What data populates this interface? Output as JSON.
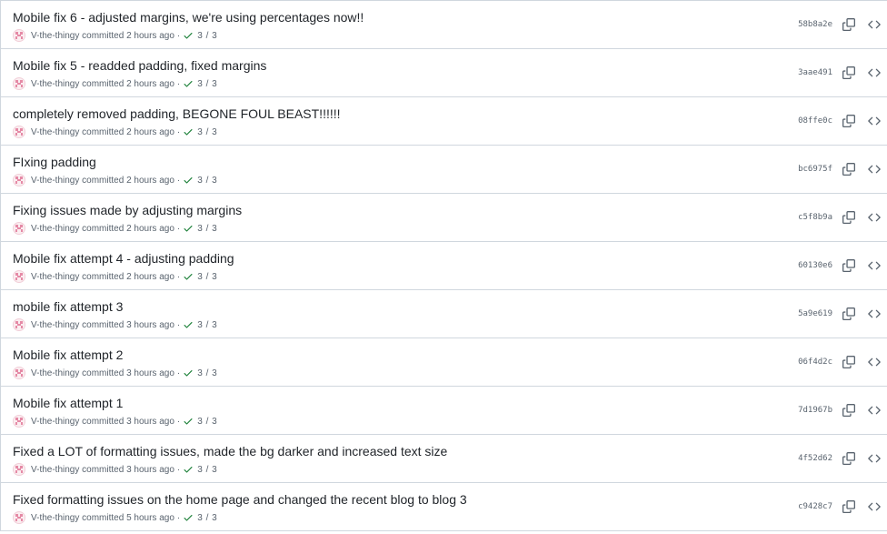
{
  "colors": {
    "border": "#d0d7de",
    "text": "#1f2328",
    "muted": "#59636e",
    "success": "#1a7f37"
  },
  "icons": {
    "avatar": "identicon-avatar-icon",
    "check": "check-icon",
    "copy": "copy-icon",
    "browse": "code-brackets-icon"
  },
  "commits": [
    {
      "message": "Mobile fix 6 - adjusted margins, we're using percentages now!!",
      "author": "V-the-thingy",
      "verb": "committed",
      "time": "2 hours ago",
      "dot": "·",
      "checks": "3 / 3",
      "sha": "58b8a2e"
    },
    {
      "message": "Mobile fix 5 - readded padding, fixed margins",
      "author": "V-the-thingy",
      "verb": "committed",
      "time": "2 hours ago",
      "dot": "·",
      "checks": "3 / 3",
      "sha": "3aae491"
    },
    {
      "message": "completely removed padding, BEGONE FOUL BEAST!!!!!!",
      "author": "V-the-thingy",
      "verb": "committed",
      "time": "2 hours ago",
      "dot": "·",
      "checks": "3 / 3",
      "sha": "08ffe0c"
    },
    {
      "message": "FIxing padding",
      "author": "V-the-thingy",
      "verb": "committed",
      "time": "2 hours ago",
      "dot": "·",
      "checks": "3 / 3",
      "sha": "bc6975f"
    },
    {
      "message": "Fixing issues made by adjusting margins",
      "author": "V-the-thingy",
      "verb": "committed",
      "time": "2 hours ago",
      "dot": "·",
      "checks": "3 / 3",
      "sha": "c5f8b9a"
    },
    {
      "message": "Mobile fix attempt 4 - adjusting padding",
      "author": "V-the-thingy",
      "verb": "committed",
      "time": "2 hours ago",
      "dot": "·",
      "checks": "3 / 3",
      "sha": "60130e6"
    },
    {
      "message": "mobile fix attempt 3",
      "author": "V-the-thingy",
      "verb": "committed",
      "time": "3 hours ago",
      "dot": "·",
      "checks": "3 / 3",
      "sha": "5a9e619"
    },
    {
      "message": "Mobile fix attempt 2",
      "author": "V-the-thingy",
      "verb": "committed",
      "time": "3 hours ago",
      "dot": "·",
      "checks": "3 / 3",
      "sha": "06f4d2c"
    },
    {
      "message": "Mobile fix attempt 1",
      "author": "V-the-thingy",
      "verb": "committed",
      "time": "3 hours ago",
      "dot": "·",
      "checks": "3 / 3",
      "sha": "7d1967b"
    },
    {
      "message": "Fixed a LOT of formatting issues, made the bg darker and increased text size",
      "author": "V-the-thingy",
      "verb": "committed",
      "time": "3 hours ago",
      "dot": "·",
      "checks": "3 / 3",
      "sha": "4f52d62"
    },
    {
      "message": "Fixed formatting issues on the home page and changed the recent blog to blog 3",
      "author": "V-the-thingy",
      "verb": "committed",
      "time": "5 hours ago",
      "dot": "·",
      "checks": "3 / 3",
      "sha": "c9428c7"
    }
  ]
}
